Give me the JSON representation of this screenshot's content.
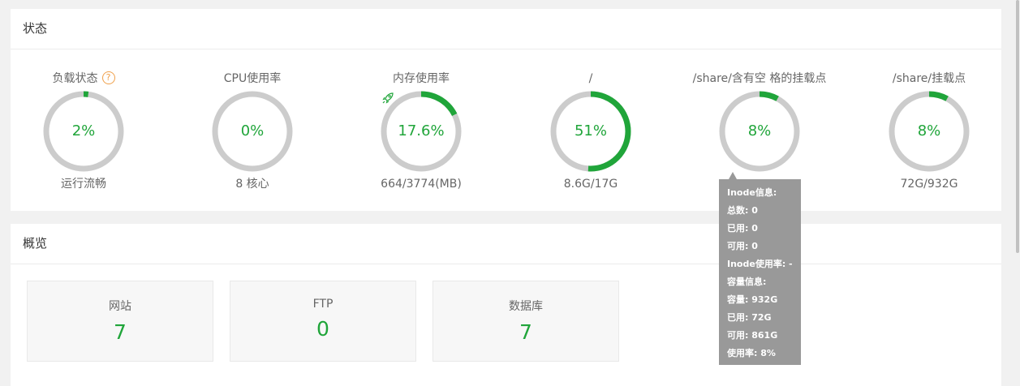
{
  "colors": {
    "accent": "#20a53a",
    "track": "#cccccc",
    "tooltip_bg": "#999999",
    "help": "#f0a04b"
  },
  "status": {
    "title": "状态",
    "gauges": [
      {
        "label": "负载状态",
        "value": "2%",
        "percent": 2,
        "sub": "运行流畅",
        "help_icon": "?"
      },
      {
        "label": "CPU使用率",
        "value": "0%",
        "percent": 0,
        "sub": "8 核心"
      },
      {
        "label": "内存使用率",
        "value": "17.6%",
        "percent": 17.6,
        "sub": "664/3774(MB)",
        "icon": "rocket-icon"
      },
      {
        "label": "/",
        "value": "51%",
        "percent": 51,
        "sub": "8.6G/17G"
      },
      {
        "label": "/share/含有空 格的挂载点",
        "value": "8%",
        "percent": 8,
        "sub": ""
      },
      {
        "label": "/share/挂载点",
        "value": "8%",
        "percent": 8,
        "sub": "72G/932G"
      }
    ]
  },
  "overview": {
    "title": "概览",
    "stats": [
      {
        "label": "网站",
        "value": "7"
      },
      {
        "label": "FTP",
        "value": "0"
      },
      {
        "label": "数据库",
        "value": "7"
      }
    ]
  },
  "tooltip": {
    "rows": [
      "Inode信息:",
      "总数: 0",
      "已用: 0",
      "可用: 0",
      "Inode使用率: -",
      "容量信息:",
      "容量: 932G",
      "已用: 72G",
      "可用: 861G",
      "使用率: 8%"
    ]
  }
}
